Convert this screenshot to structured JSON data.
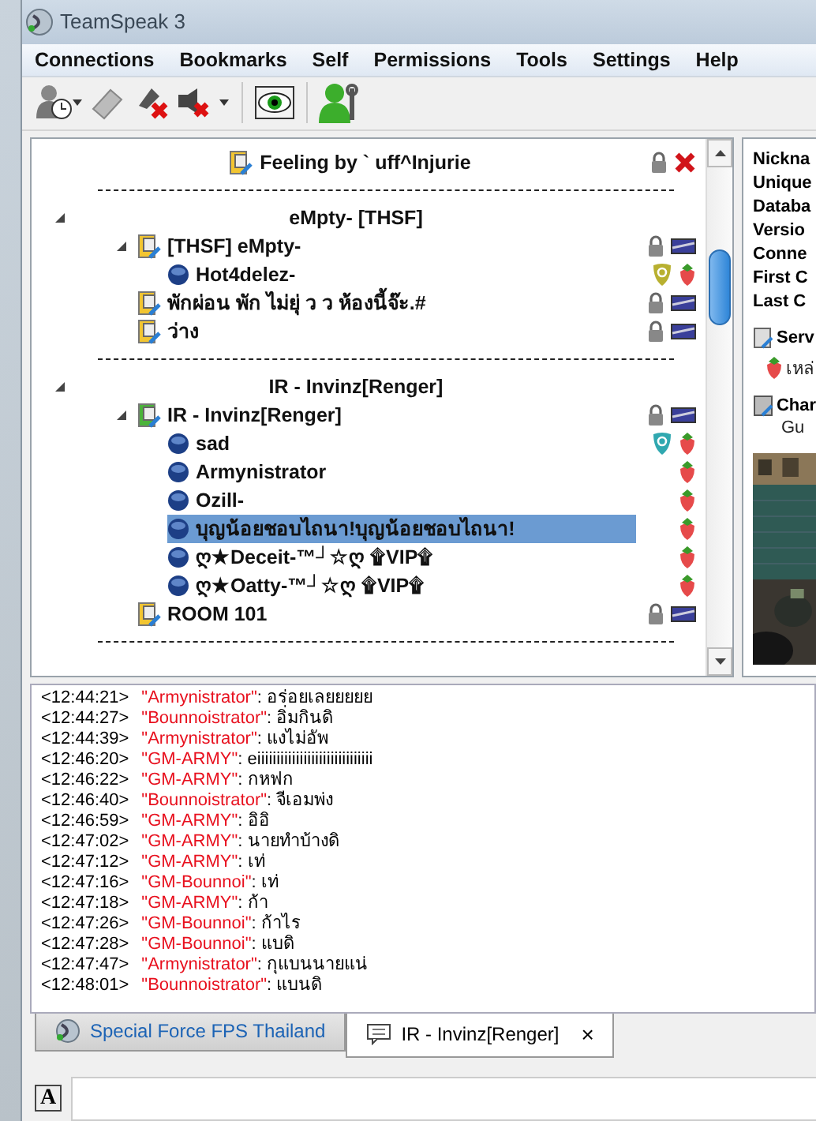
{
  "window": {
    "title": "TeamSpeak 3"
  },
  "menu": [
    "Connections",
    "Bookmarks",
    "Self",
    "Permissions",
    "Tools",
    "Settings",
    "Help"
  ],
  "tree": [
    {
      "kind": "title_channel",
      "label": "Feeling by ` uff^Injurie",
      "icons": [
        {
          "kind": "lock"
        },
        {
          "kind": "deny"
        }
      ]
    },
    {
      "kind": "separator"
    },
    {
      "kind": "spacer",
      "label": "eMpty-  [THSF]",
      "expanded": true,
      "children": [
        {
          "kind": "channel",
          "label": "[THSF] eMpty-",
          "current": false,
          "expanded": true,
          "icons": [
            {
              "kind": "lock"
            },
            {
              "kind": "banner"
            }
          ],
          "children": [
            {
              "kind": "client",
              "label": "Hot4delez-",
              "selected": false,
              "icons": [
                {
                  "kind": "shield_gold"
                },
                {
                  "kind": "strawberry"
                }
              ]
            }
          ]
        },
        {
          "kind": "channel",
          "label": "พักผ่อน พัก ไม่ยุ่ ว ว ห้องนี้จ๊ะ.#",
          "current": false,
          "icons": [
            {
              "kind": "lock"
            },
            {
              "kind": "banner"
            }
          ]
        },
        {
          "kind": "channel",
          "label": "ว่าง",
          "current": false,
          "icons": [
            {
              "kind": "lock"
            },
            {
              "kind": "banner"
            }
          ]
        }
      ]
    },
    {
      "kind": "separator"
    },
    {
      "kind": "spacer",
      "label": "IR - Invinz[Renger]",
      "expanded": true,
      "children": [
        {
          "kind": "channel",
          "label": "IR - Invinz[Renger]",
          "current": true,
          "expanded": true,
          "icons": [
            {
              "kind": "lock"
            },
            {
              "kind": "banner"
            }
          ],
          "children": [
            {
              "kind": "client",
              "label": "sad",
              "selected": false,
              "icons": [
                {
                  "kind": "shield_teal"
                },
                {
                  "kind": "strawberry"
                }
              ]
            },
            {
              "kind": "client",
              "label": "Armynistrator",
              "selected": false,
              "icons": [
                {
                  "kind": "strawberry"
                }
              ]
            },
            {
              "kind": "client",
              "label": "Ozill-",
              "selected": false,
              "icons": [
                {
                  "kind": "strawberry"
                }
              ]
            },
            {
              "kind": "client",
              "label": "บุญน้อยชอบไถนา!บุญน้อยชอบไถนา!",
              "selected": true,
              "icons": [
                {
                  "kind": "strawberry"
                }
              ]
            },
            {
              "kind": "client",
              "label": "ღ★Deceit-™┘☆ღ ۩VIP۩",
              "selected": false,
              "icons": [
                {
                  "kind": "strawberry"
                }
              ]
            },
            {
              "kind": "client",
              "label": "ღ★Oatty-™┘☆ღ ۩VIP۩",
              "selected": false,
              "icons": [
                {
                  "kind": "strawberry"
                }
              ]
            }
          ]
        },
        {
          "kind": "channel",
          "label": "ROOM 101",
          "current": false,
          "icons": [
            {
              "kind": "lock"
            },
            {
              "kind": "banner"
            }
          ]
        }
      ]
    },
    {
      "kind": "separator"
    }
  ],
  "info": {
    "fields": [
      "Nickna",
      "Unique",
      "Databa",
      "Versio",
      "Conne",
      "First C",
      "Last C"
    ],
    "server_heading": "Serv",
    "server_group": "เหล่",
    "channel_heading": "Char",
    "channel_group": "Gu"
  },
  "chat": [
    {
      "time": "<12:44:21>",
      "name": "\"Armynistrator\"",
      "text": ": อร่อยเลยยยยย"
    },
    {
      "time": "<12:44:27>",
      "name": "\"Bounnoistrator\"",
      "text": ": อิ่มกินดิ"
    },
    {
      "time": "<12:44:39>",
      "name": "\"Armynistrator\"",
      "text": ": แงไม่อัพ"
    },
    {
      "time": "<12:46:20>",
      "name": "\"GM-ARMY\"",
      "text": ": eiiiiiiiiiiiiiiiiiiiiiiiiiiiiii"
    },
    {
      "time": "<12:46:22>",
      "name": "\"GM-ARMY\"",
      "text": ": กหฟก"
    },
    {
      "time": "<12:46:40>",
      "name": "\"Bounnoistrator\"",
      "text": ": จีเอมพ่ง"
    },
    {
      "time": "<12:46:59>",
      "name": "\"GM-ARMY\"",
      "text": ": อิอิ"
    },
    {
      "time": "<12:47:02>",
      "name": "\"GM-ARMY\"",
      "text": ": นายทำบ้างดิ"
    },
    {
      "time": "<12:47:12>",
      "name": "\"GM-ARMY\"",
      "text": ": เท่"
    },
    {
      "time": "<12:47:16>",
      "name": "\"GM-Bounnoi\"",
      "text": ": เท่"
    },
    {
      "time": "<12:47:18>",
      "name": "\"GM-ARMY\"",
      "text": ": ก้า"
    },
    {
      "time": "<12:47:26>",
      "name": "\"GM-Bounnoi\"",
      "text": ": ก้าไร"
    },
    {
      "time": "<12:47:28>",
      "name": "\"GM-Bounnoi\"",
      "text": ": แบดิ"
    },
    {
      "time": "<12:47:47>",
      "name": "\"Armynistrator\"",
      "text": ": กุแบนนายแน่"
    },
    {
      "time": "<12:48:01>",
      "name": "\"Bounnoistrator\"",
      "text": ": แบนดิ"
    }
  ],
  "tabs": [
    {
      "kind": "server",
      "label": "Special Force FPS Thailand",
      "selected": false
    },
    {
      "kind": "channel",
      "label": "IR - Invinz[Renger]",
      "selected": true,
      "close": "×"
    }
  ],
  "input": {
    "format_button": "A"
  }
}
